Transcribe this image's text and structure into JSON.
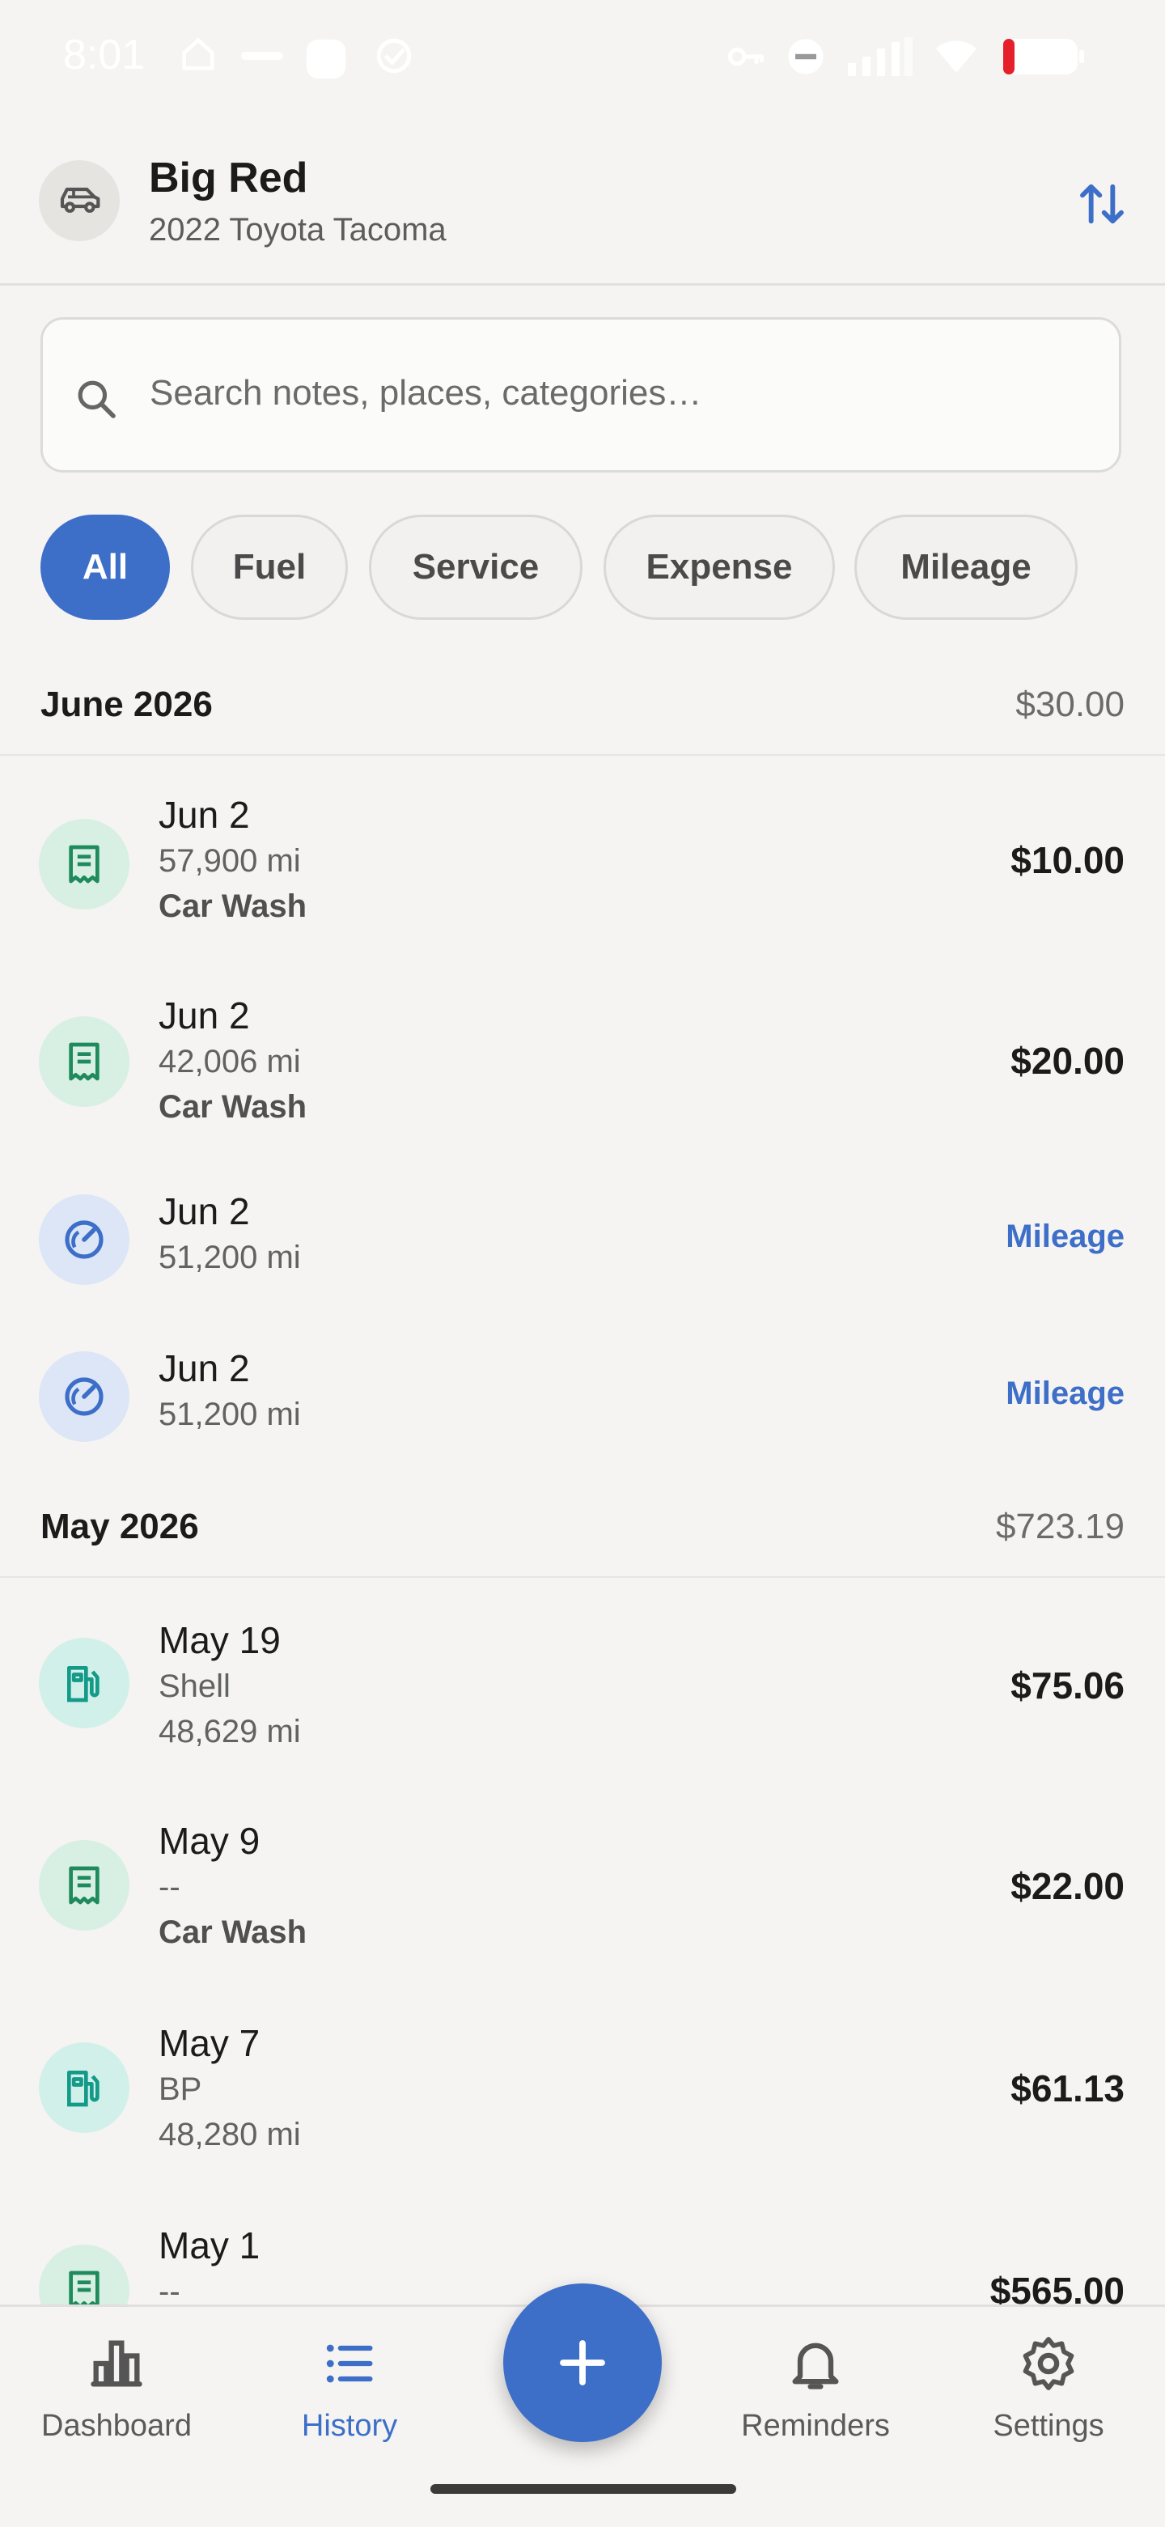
{
  "status": {
    "time": "8:01"
  },
  "header": {
    "vehicle_name": "Big Red",
    "vehicle_model": "2022 Toyota Tacoma"
  },
  "search": {
    "placeholder": "Search notes, places, categories…"
  },
  "filters": [
    {
      "label": "All",
      "active": true
    },
    {
      "label": "Fuel",
      "active": false
    },
    {
      "label": "Service",
      "active": false
    },
    {
      "label": "Expense",
      "active": false
    },
    {
      "label": "Mileage",
      "active": false
    }
  ],
  "months": [
    {
      "label": "June 2026",
      "total": "$30.00",
      "entries": [
        {
          "icon": "receipt-icon",
          "date": "Jun 2",
          "line2": "57,900 mi",
          "category": "Car Wash",
          "amount": "$10.00"
        },
        {
          "icon": "receipt-icon",
          "date": "Jun 2",
          "line2": "42,006 mi",
          "category": "Car Wash",
          "amount": "$20.00"
        },
        {
          "icon": "speedometer-icon",
          "date": "Jun 2",
          "line2": "51,200 mi",
          "tag": "Mileage"
        },
        {
          "icon": "speedometer-icon",
          "date": "Jun 2",
          "line2": "51,200 mi",
          "tag": "Mileage"
        }
      ]
    },
    {
      "label": "May 2026",
      "total": "$723.19",
      "entries": [
        {
          "icon": "fuel-pump-icon",
          "date": "May 19",
          "line2": "Shell",
          "line3": "48,629 mi",
          "amount": "$75.06"
        },
        {
          "icon": "receipt-icon",
          "date": "May 9",
          "line2": "--",
          "category": "Car Wash",
          "amount": "$22.00"
        },
        {
          "icon": "fuel-pump-icon",
          "date": "May 7",
          "line2": "BP",
          "line3": "48,280 mi",
          "amount": "$61.13"
        },
        {
          "icon": "receipt-icon",
          "date": "May 1",
          "line2": "--",
          "amount": "$565.00"
        }
      ]
    }
  ],
  "nav": {
    "dashboard": "Dashboard",
    "history": "History",
    "reminders": "Reminders",
    "settings": "Settings"
  },
  "colors": {
    "accent": "#3d6fc8",
    "background": "#f5f4f2",
    "receipt_icon": "#1f8a5b",
    "fuel_icon": "#139a88"
  }
}
